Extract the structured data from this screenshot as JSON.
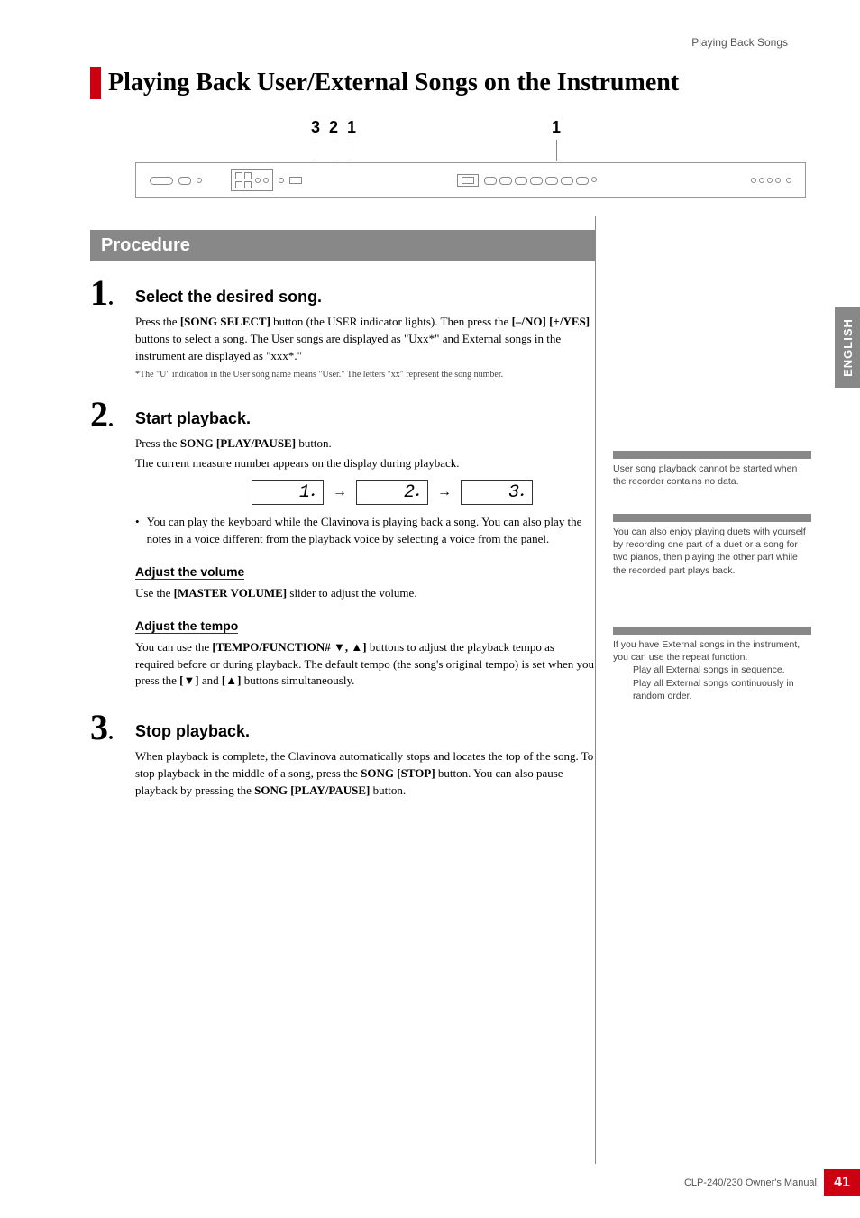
{
  "header_right": "Playing Back Songs",
  "title": "Playing Back User/External Songs on the Instrument",
  "diagram": {
    "n3": "3",
    "n2": "2",
    "n1a": "1",
    "n1b": "1"
  },
  "procedure_label": "Procedure",
  "step1": {
    "num": "1",
    "heading": "Select the desired song.",
    "p1a": "Press the ",
    "p1b": "[SONG SELECT]",
    "p1c": " button (the USER indicator lights). Then press the ",
    "p1d": "[–/NO] [+/YES]",
    "p1e": " buttons to select a song. The User songs are displayed as \"Uxx*\" and External songs in the instrument are displayed as \"xxx*.\"",
    "foot": "*The \"U\" indication in the User song name means \"User.\" The letters \"xx\" represent the song number."
  },
  "step2": {
    "num": "2",
    "heading": "Start playback.",
    "p1a": "Press the ",
    "p1b": "SONG [PLAY/PAUSE]",
    "p1c": " button.",
    "p2": "The current measure number appears on the display during playback.",
    "seg1": "1",
    "seg2": "2",
    "seg3": "3",
    "bullet": "You can play the keyboard while the Clavinova is playing back a song. You can also play the notes in a voice different from the playback voice by selecting a voice from the panel.",
    "sub1": "Adjust the volume",
    "sub1_p_a": "Use the ",
    "sub1_p_b": "[MASTER VOLUME]",
    "sub1_p_c": " slider to adjust the volume.",
    "sub2": "Adjust the tempo",
    "sub2_p_a": "You can use the ",
    "sub2_p_b": "[TEMPO/FUNCTION# ▼, ▲]",
    "sub2_p_c": " buttons to adjust the playback tempo as required before or during playback. The default tempo (the song's original tempo) is set when you press the ",
    "sub2_p_d": "[▼]",
    "sub2_p_e": " and ",
    "sub2_p_f": "[▲]",
    "sub2_p_g": " buttons simultaneously."
  },
  "step3": {
    "num": "3",
    "heading": "Stop playback.",
    "p_a": "When playback is complete, the Clavinova automatically stops and locates the top of the song. To stop playback in the middle of a song, press the ",
    "p_b": "SONG [STOP]",
    "p_c": " button. You can also pause playback by pressing the ",
    "p_d": "SONG [PLAY/PAUSE]",
    "p_e": " button."
  },
  "side_tab": "ENGLISH",
  "note1": "User song playback cannot be started when the recorder contains no data.",
  "note2": "You can also enjoy playing duets with yourself by recording one part of a duet or a song for two pianos, then playing the other part while the recorded part plays back.",
  "note3_a": "If you have External songs in the instrument, you can use the repeat function.",
  "note3_b": "Play all External songs in sequence.",
  "note3_c": "Play all External songs continuously in random order.",
  "footer_text": "CLP-240/230 Owner's Manual",
  "page_num": "41"
}
